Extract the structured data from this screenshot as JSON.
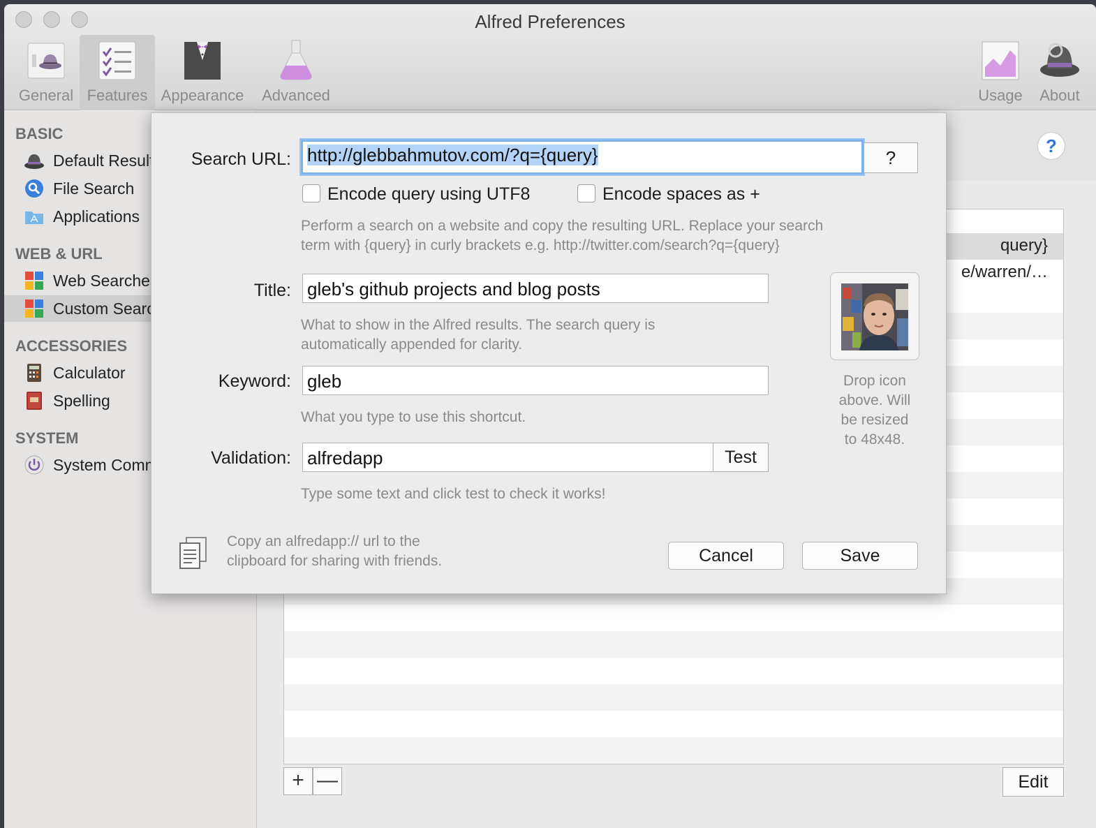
{
  "window": {
    "title": "Alfred Preferences"
  },
  "toolbar": {
    "items": [
      {
        "label": "General",
        "icon": "general-hat-icon"
      },
      {
        "label": "Features",
        "icon": "features-checklist-icon"
      },
      {
        "label": "Appearance",
        "icon": "appearance-tuxedo-icon"
      },
      {
        "label": "Advanced",
        "icon": "advanced-flask-icon"
      },
      {
        "label": "Usage",
        "icon": "usage-chart-icon"
      },
      {
        "label": "About",
        "icon": "about-hat-icon"
      }
    ]
  },
  "sidebar": {
    "sections": [
      {
        "title": "BASIC",
        "items": [
          "Default Results",
          "File Search",
          "Applications"
        ]
      },
      {
        "title": "WEB & URL",
        "items": [
          "Web Searches",
          "Custom Searches"
        ]
      },
      {
        "title": "ACCESSORIES",
        "items": [
          "Calculator",
          "Spelling"
        ]
      },
      {
        "title": "SYSTEM",
        "items": [
          "System Commands"
        ]
      }
    ],
    "selected": "Custom Searches"
  },
  "main": {
    "help_label": "?",
    "rows": [
      "query}",
      "e/warren/…"
    ],
    "add_label": "+",
    "remove_label": "—",
    "edit_label": "Edit"
  },
  "sheet": {
    "search_url_label": "Search URL:",
    "search_url_value": "http://glebbahmutov.com/?q={query}",
    "help_button": "?",
    "encode_utf8_label": "Encode query using UTF8",
    "encode_spaces_label": "Encode spaces as +",
    "url_hint_1": "Perform a search on a website and copy the resulting URL. Replace your search",
    "url_hint_2": "term with {query} in curly brackets e.g. http://twitter.com/search?q={query}",
    "title_label": "Title:",
    "title_value": "gleb's github projects and blog posts",
    "title_hint_1": "What to show in the Alfred results. The search query is",
    "title_hint_2": "automatically appended for clarity.",
    "keyword_label": "Keyword:",
    "keyword_value": "gleb",
    "keyword_hint": "What you type to use this shortcut.",
    "validation_label": "Validation:",
    "validation_value": "alfredapp",
    "test_button": "Test",
    "validation_hint": "Type some text and click test to check it works!",
    "drop_icon_1": "Drop icon",
    "drop_icon_2": "above. Will",
    "drop_icon_3": "be resized",
    "drop_icon_4": "to 48x48.",
    "copy_hint_1": "Copy an alfredapp:// url to the",
    "copy_hint_2": "clipboard for sharing with friends.",
    "cancel_button": "Cancel",
    "save_button": "Save"
  }
}
